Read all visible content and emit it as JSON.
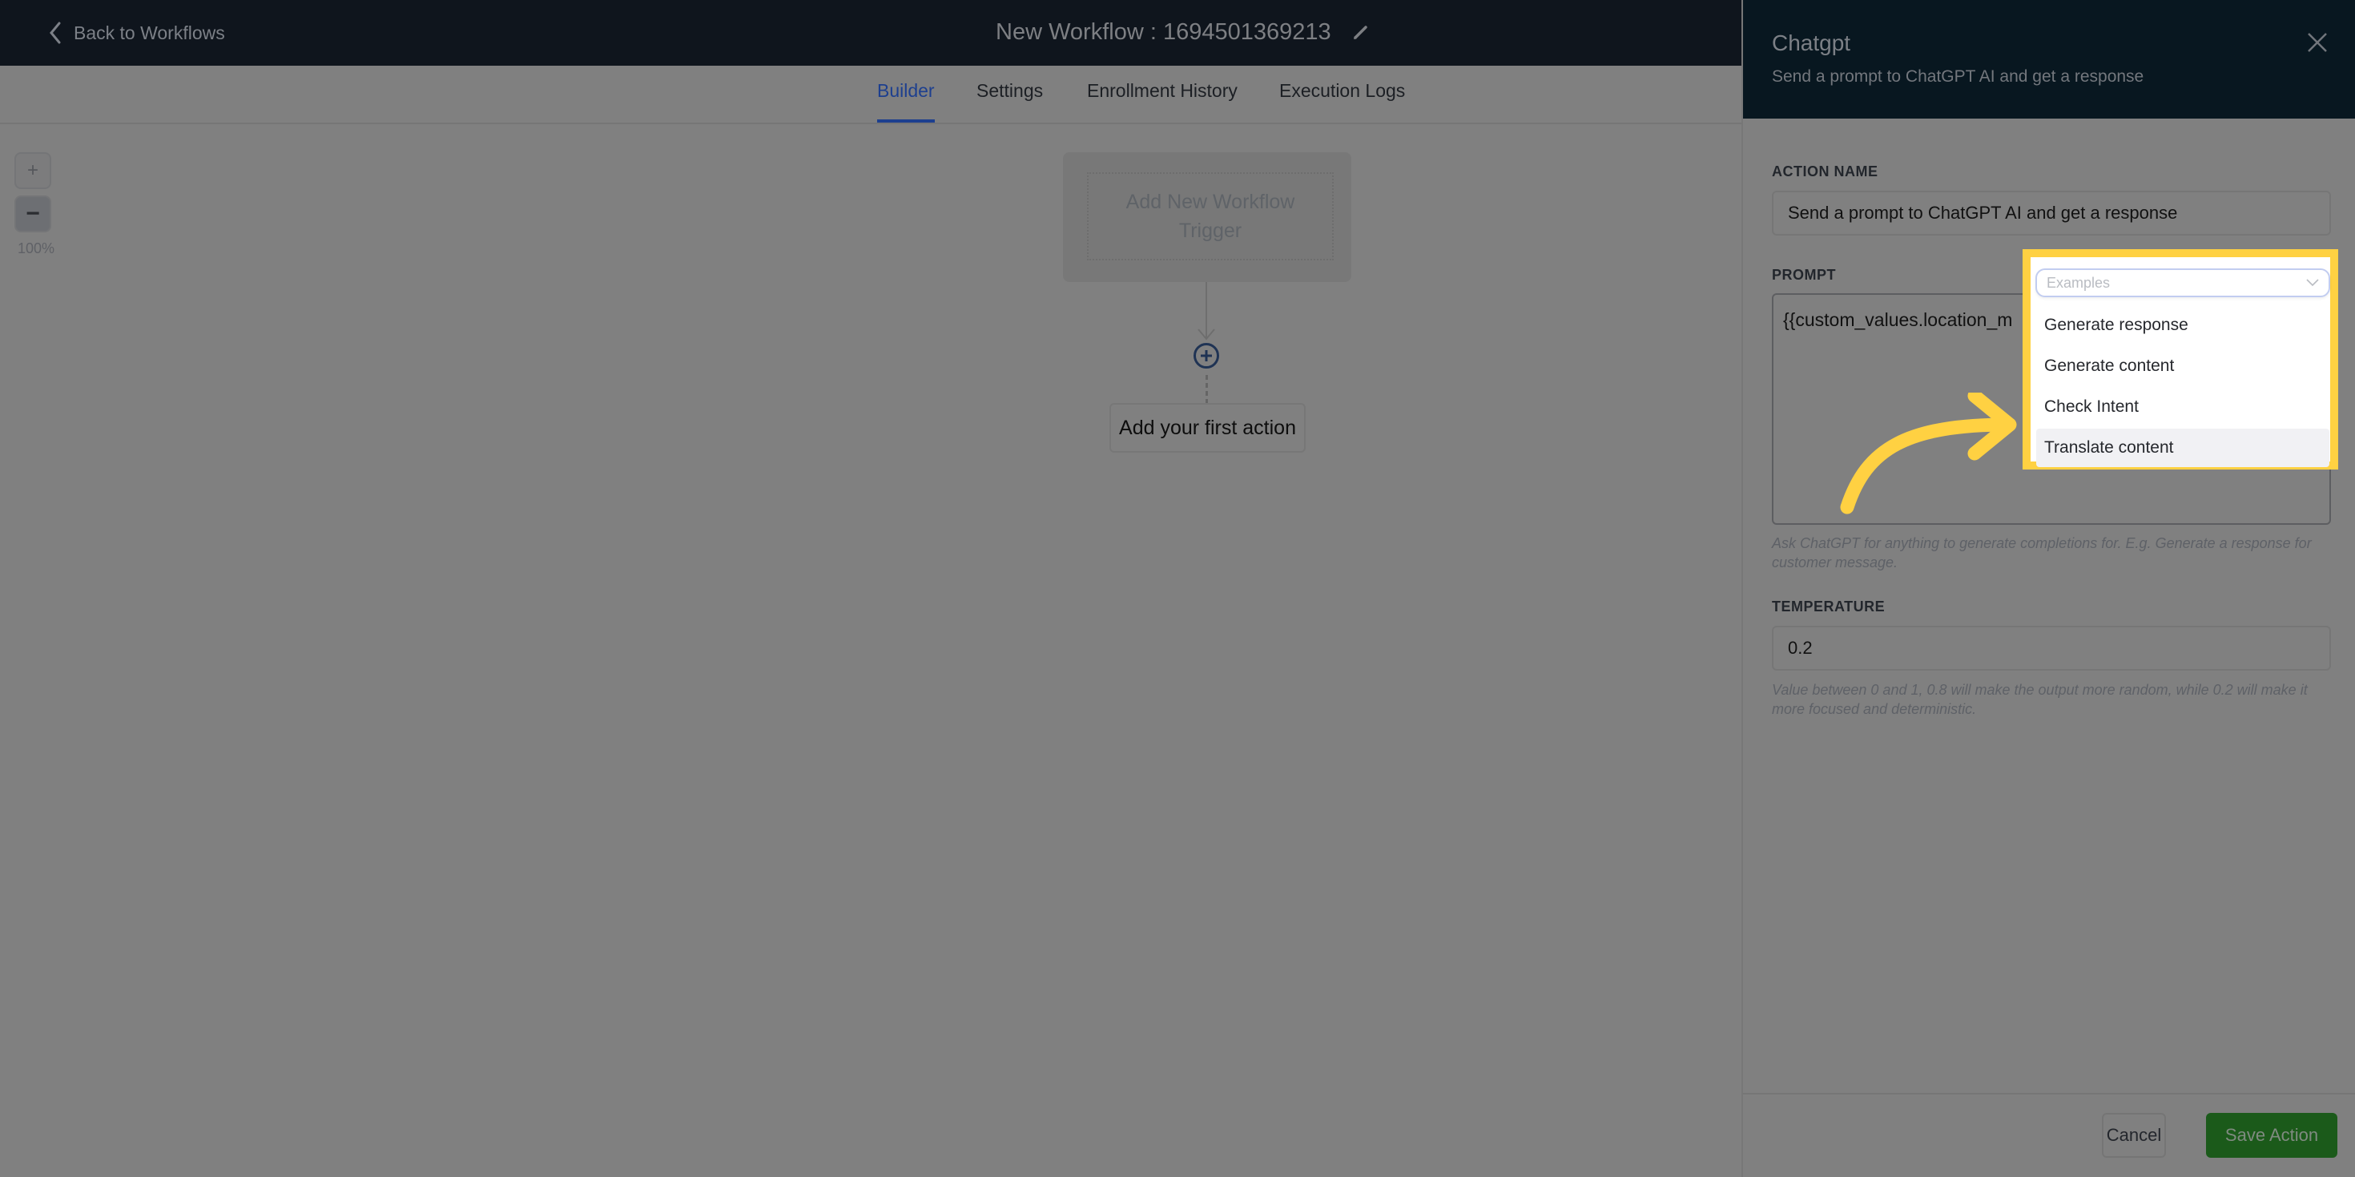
{
  "header": {
    "back_label": "Back to Workflows",
    "workflow_title": "New Workflow : 1694501369213"
  },
  "tabs": [
    {
      "label": "Builder",
      "active": true
    },
    {
      "label": "Settings",
      "active": false
    },
    {
      "label": "Enrollment History",
      "active": false
    },
    {
      "label": "Execution Logs",
      "active": false
    }
  ],
  "canvas": {
    "zoom_in_label": "+",
    "zoom_out_label": "−",
    "zoom_level": "100%",
    "trigger_label_line1": "Add New Workflow",
    "trigger_label_line2": "Trigger",
    "first_action_label": "Add your first action"
  },
  "panel": {
    "title": "Chatgpt",
    "subtitle": "Send a prompt to ChatGPT AI and get a response",
    "action_name_label": "ACTION NAME",
    "action_name_value": "Send a prompt to ChatGPT AI and get a response",
    "prompt_label": "PROMPT",
    "prompt_value": "{{custom_values.location_m",
    "prompt_hint": "Ask ChatGPT for anything to generate completions for. E.g. Generate a response for customer message.",
    "temperature_label": "TEMPERATURE",
    "temperature_value": "0.2",
    "temperature_hint": "Value between 0 and 1, 0.8 will make the output more random, while 0.2 will make it more focused and deterministic.",
    "cancel_label": "Cancel",
    "save_label": "Save Action"
  },
  "examples_dropdown": {
    "placeholder": "Examples",
    "options": [
      {
        "label": "Generate response",
        "hovered": false
      },
      {
        "label": "Generate content",
        "hovered": false
      },
      {
        "label": "Check Intent",
        "hovered": false
      },
      {
        "label": "Translate content",
        "hovered": true
      }
    ]
  },
  "colors": {
    "topbar_bg": "#0f151d",
    "panel_head_bg": "#081720",
    "active_tab": "#1d3f8f",
    "save_button": "#1b5a1a",
    "highlight": "#ffd142"
  }
}
